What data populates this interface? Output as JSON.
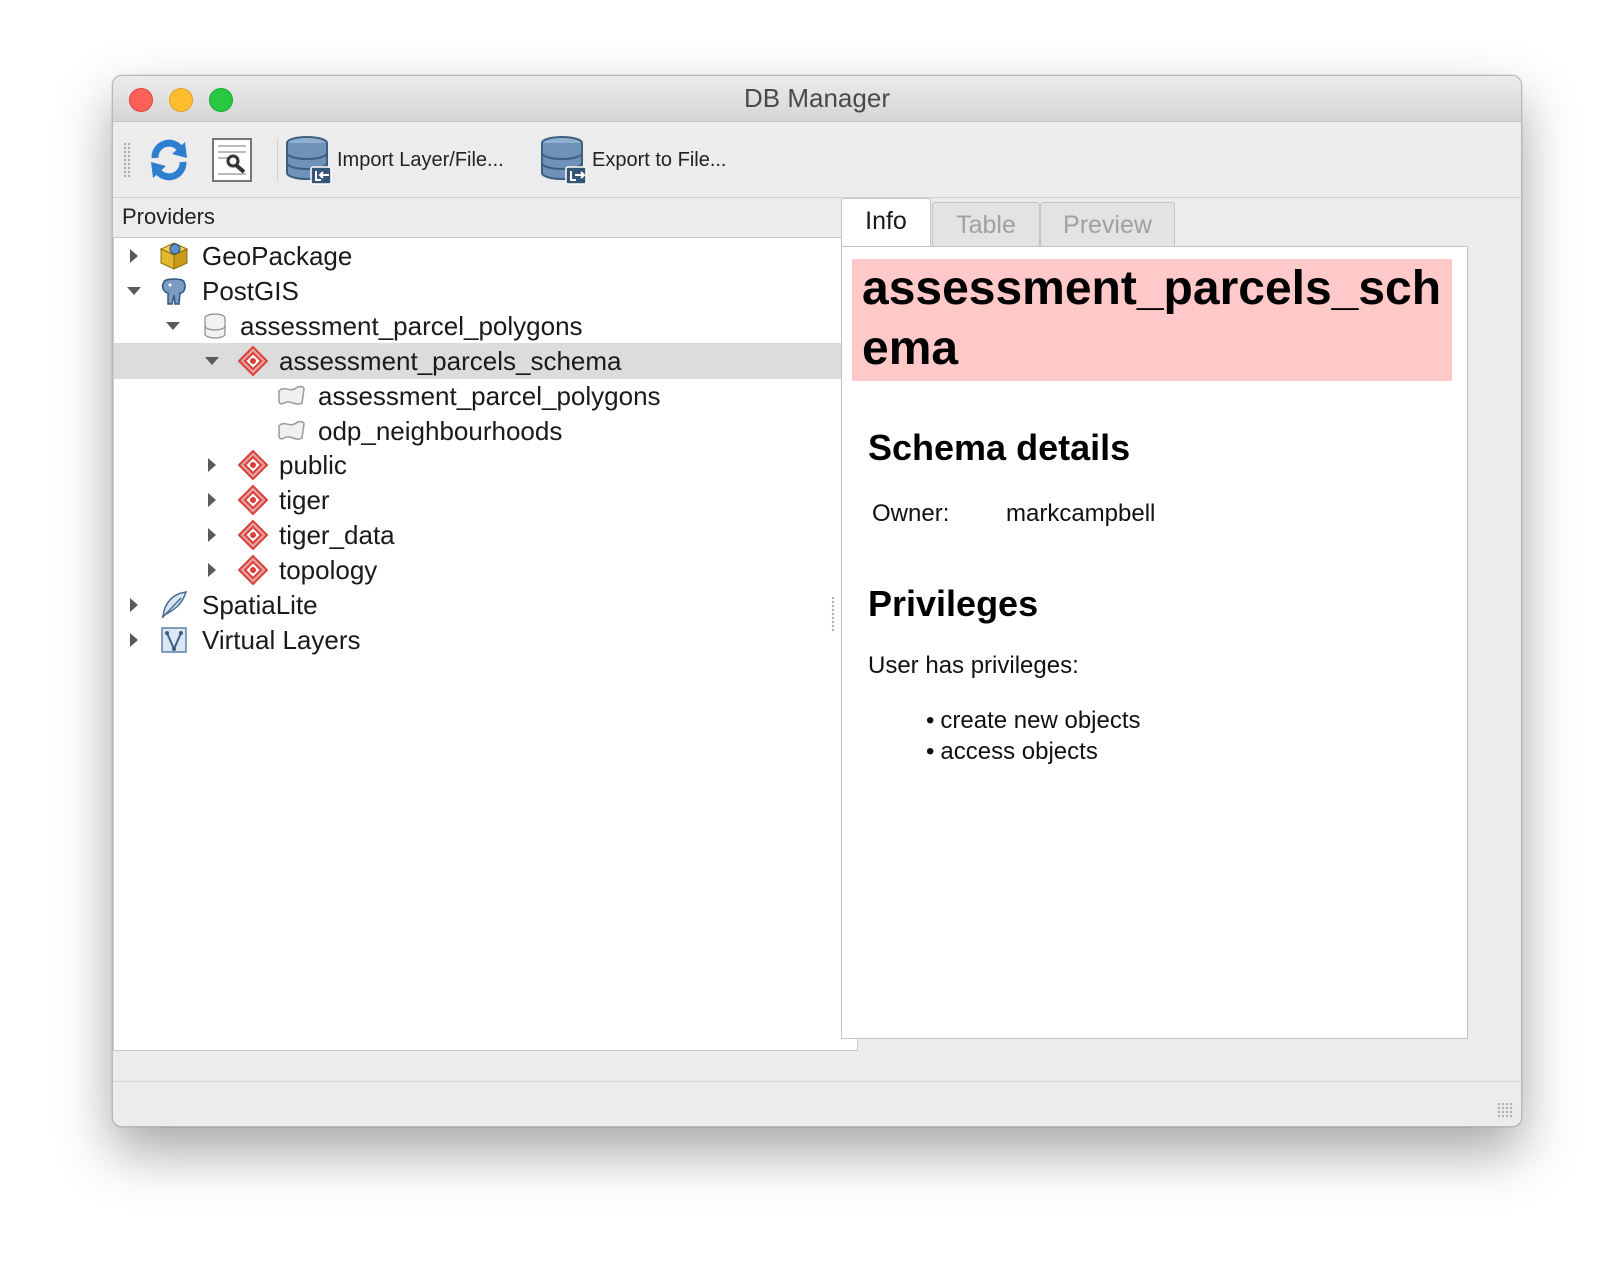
{
  "window": {
    "title": "DB Manager"
  },
  "toolbar": {
    "refresh_icon": "refresh-icon",
    "sql_window_icon": "sql-window-icon",
    "import_label": "Import Layer/File...",
    "export_label": "Export to File..."
  },
  "providers": {
    "label": "Providers",
    "items": {
      "geopackage": "GeoPackage",
      "postgis": "PostGIS",
      "connection": "assessment_parcel_polygons",
      "schema_selected": "assessment_parcels_schema",
      "table1": "assessment_parcel_polygons",
      "table2": "odp_neighbourhoods",
      "public": "public",
      "tiger": "tiger",
      "tiger_data": "tiger_data",
      "topology": "topology",
      "spatialite": "SpatiaLite",
      "virtual_layers": "Virtual Layers"
    }
  },
  "tabs": {
    "info": "Info",
    "table": "Table",
    "preview": "Preview"
  },
  "info": {
    "heading": "assessment_parcels_schema",
    "schema_details_title": "Schema details",
    "owner_label": "Owner:",
    "owner_value": "markcampbell",
    "privileges_title": "Privileges",
    "privileges_intro": "User has privileges:",
    "privileges": [
      "create new objects",
      "access objects"
    ]
  },
  "colors": {
    "heading_bg": "#ffc9c9",
    "selected_row": "#dcdcdc",
    "schema_icon": "#d9403a"
  }
}
